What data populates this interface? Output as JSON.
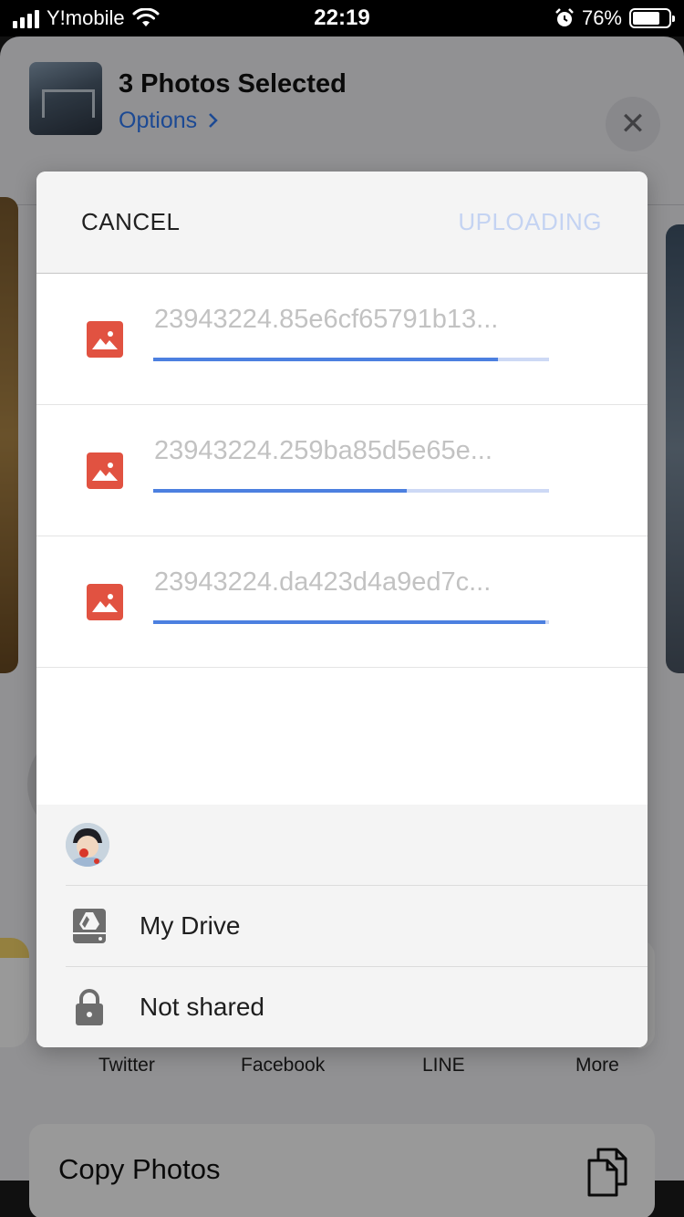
{
  "status_bar": {
    "carrier": "Y!mobile",
    "time": "22:19",
    "battery_percent": "76%",
    "battery_level": 0.76
  },
  "share_sheet": {
    "title": "3 Photos Selected",
    "options_label": "Options",
    "close_label": "✕",
    "apps": [
      "Twitter",
      "Facebook",
      "LINE",
      "More"
    ],
    "copy_photos_label": "Copy Photos"
  },
  "upload_dialog": {
    "cancel_label": "CANCEL",
    "uploading_label": "UPLOADING",
    "files": [
      {
        "name": "23943224.85e6cf65791b13...",
        "progress": 0.87
      },
      {
        "name": "23943224.259ba85d5e65e...",
        "progress": 0.64
      },
      {
        "name": "23943224.da423d4a9ed7c...",
        "progress": 0.99
      }
    ],
    "destination": {
      "folder_label": "My Drive",
      "sharing_label": "Not shared"
    }
  },
  "colors": {
    "accent_blue": "#4c80e0",
    "track_blue": "#cdd9f5",
    "file_icon_red": "#e15241",
    "uploading_disabled": "#c4d3f2",
    "ios_link_blue": "#2f7bf5"
  },
  "icons": [
    "signal-icon",
    "wifi-icon",
    "alarm-icon",
    "battery-icon",
    "close-icon",
    "chevron-right-icon",
    "image-file-icon",
    "drive-icon",
    "lock-icon",
    "copy-icon"
  ]
}
